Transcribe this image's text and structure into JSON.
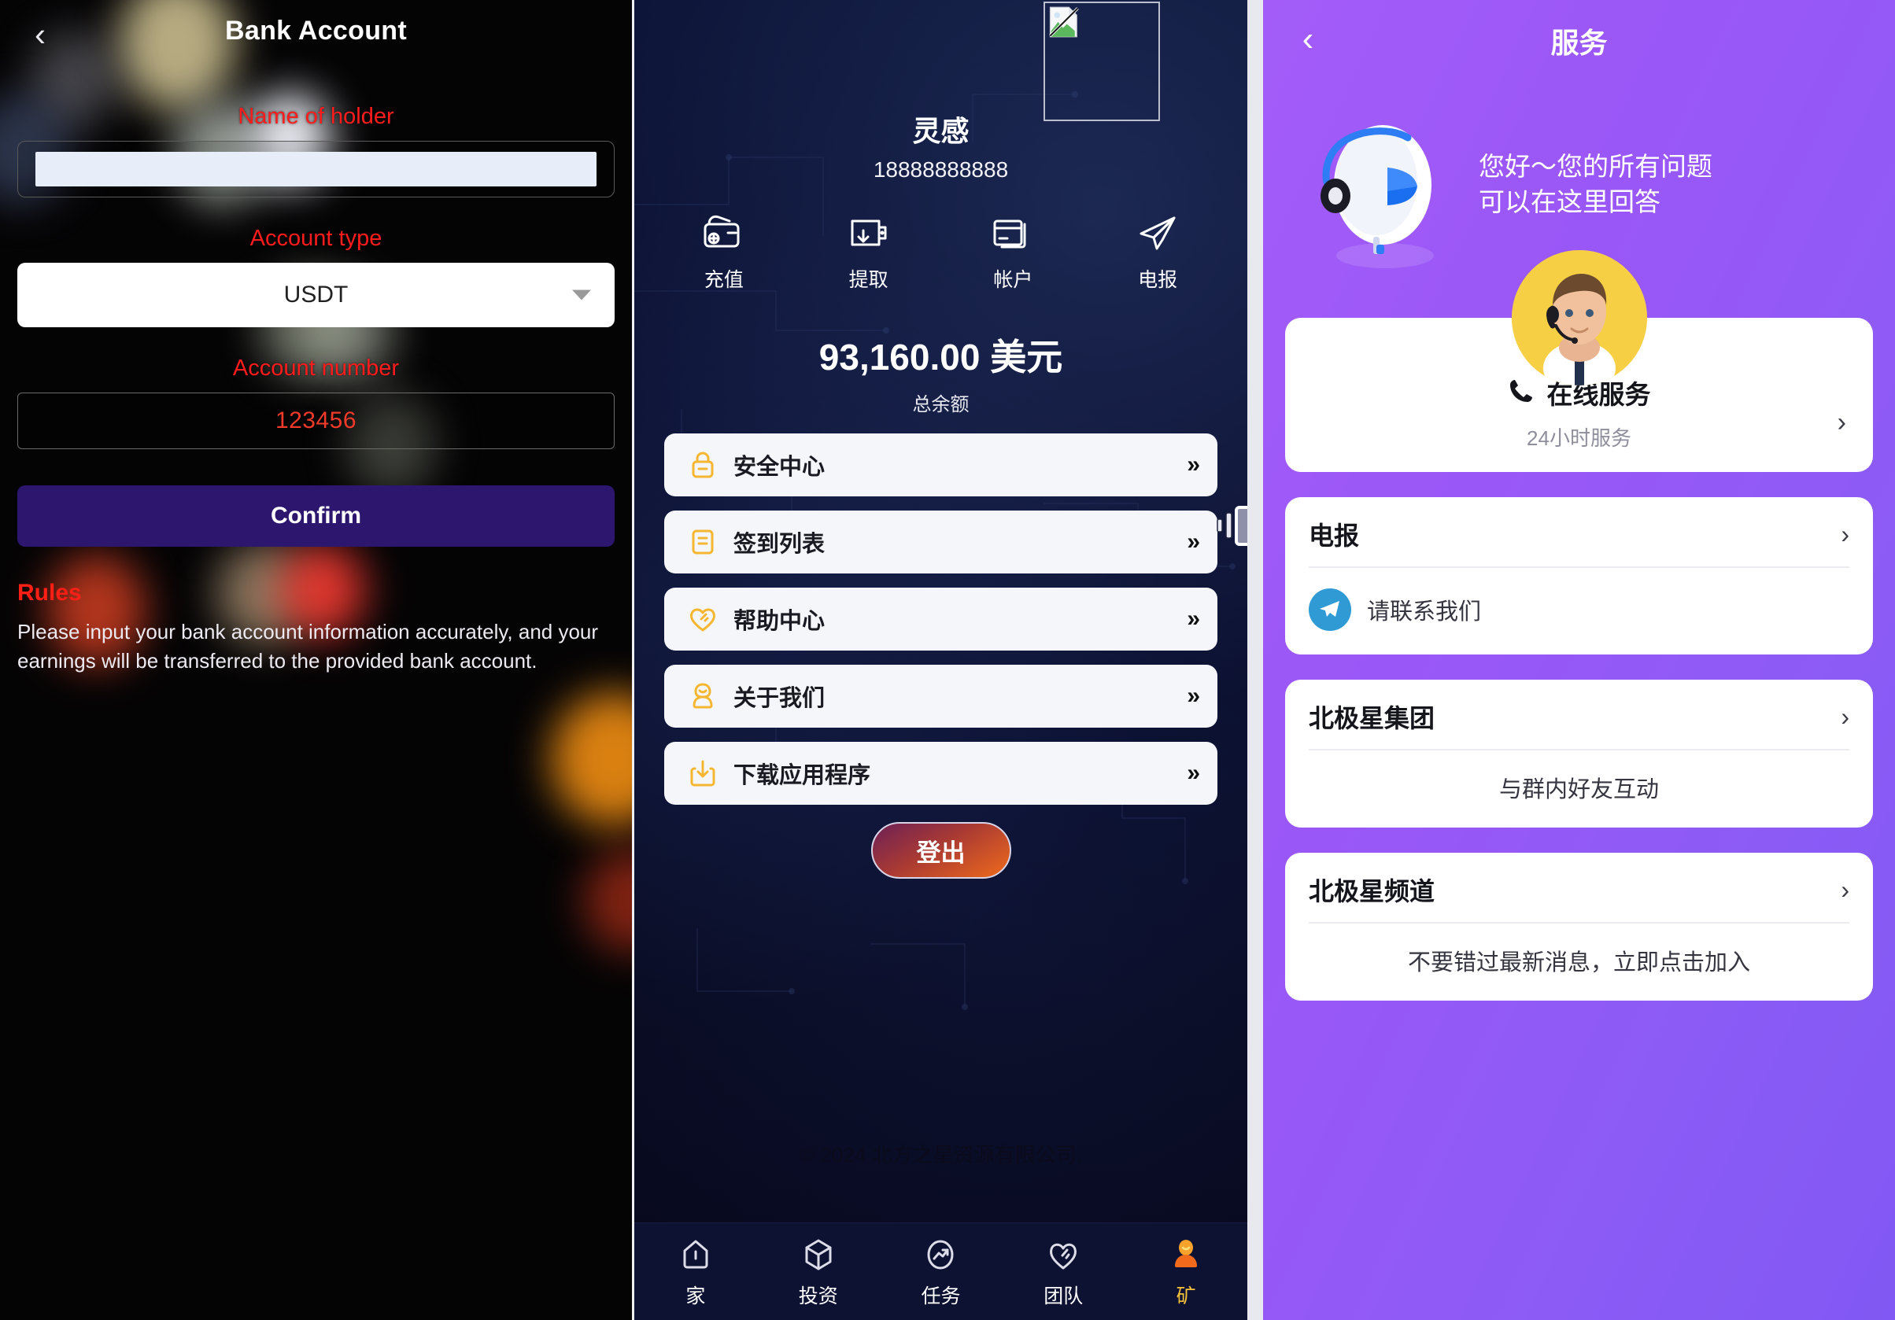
{
  "panel1": {
    "back_icon": "chevron-left-icon",
    "title": "Bank Account",
    "name_label": "Name of holder",
    "name_value": "",
    "name_placeholder": "",
    "type_label": "Account type",
    "type_value": "USDT",
    "caret_icon": "chevron-down-icon",
    "number_label": "Account number",
    "number_value": "123456",
    "confirm_label": "Confirm",
    "rules_heading": "Rules",
    "rules_body": "Please input your bank account information accurately, and your earnings will be transferred to the provided bank account.",
    "colors": {
      "label_red": "#ff1c1c",
      "confirm_bg": "#2c166e",
      "rules_red": "#fb1f16"
    }
  },
  "panel2": {
    "broken_image_icon": "broken-image-placeholder-icon",
    "speaker_icon": "volume-speaker-icon",
    "user_name": "灵感",
    "user_phone": "18888888888",
    "quick_actions": [
      {
        "icon": "wallet-recharge-icon",
        "label": "充值"
      },
      {
        "icon": "wallet-withdraw-icon",
        "label": "提取"
      },
      {
        "icon": "card-account-icon",
        "label": "帐户"
      },
      {
        "icon": "telegram-paperplane-icon",
        "label": "电报"
      }
    ],
    "balance": "93,160.00 美元",
    "balance_sub": "总余额",
    "menu": [
      {
        "icon": "lock-icon",
        "label": "安全中心",
        "arrow": "»"
      },
      {
        "icon": "list-checkin-icon",
        "label": "签到列表",
        "arrow": "»"
      },
      {
        "icon": "heart-help-icon",
        "label": "帮助中心",
        "arrow": "»"
      },
      {
        "icon": "person-about-icon",
        "label": "关于我们",
        "arrow": "»"
      },
      {
        "icon": "download-icon",
        "label": "下载应用程序",
        "arrow": "»"
      }
    ],
    "logout_label": "登出",
    "copyright": "© 2024 北方之星资源有限公司.",
    "tabs": [
      {
        "icon": "home-icon",
        "label": "家",
        "active": false
      },
      {
        "icon": "cube-invest-icon",
        "label": "投资",
        "active": false
      },
      {
        "icon": "trend-task-icon",
        "label": "任务",
        "active": false
      },
      {
        "icon": "heart-team-icon",
        "label": "团队",
        "active": false
      },
      {
        "icon": "miner-icon",
        "label": "矿",
        "active": true
      }
    ],
    "colors": {
      "menu_icon": "#f5b731",
      "active_tab": "#f6c23a",
      "card_bg": "#f5f6fa"
    }
  },
  "panel3": {
    "back_icon": "chevron-left-icon",
    "title": "服务",
    "robot_icon": "headset-robot-icon",
    "hero_line1": "您好～您的所有问题",
    "hero_line2": "可以在这里回答",
    "avatar_icon": "support-agent-avatar",
    "main_card": {
      "phone_icon": "phone-icon",
      "title": "在线服务",
      "subtitle": "24小时服务",
      "chevron": "›"
    },
    "cards": [
      {
        "title": "电报",
        "chevron": "›",
        "icon": "telegram-icon",
        "body": "请联系我们",
        "body_centered": false
      },
      {
        "title": "北极星集团",
        "chevron": "›",
        "icon": "",
        "body": "与群内好友互动",
        "body_centered": true
      },
      {
        "title": "北极星频道",
        "chevron": "›",
        "icon": "",
        "body": "不要错过最新消息，立即点击加入",
        "body_centered": true
      }
    ],
    "colors": {
      "bg_from": "#a35cf8",
      "bg_to": "#8158f3",
      "avatar_bg": "#f6cf45",
      "telegram_blue": "#2f9ad4"
    }
  }
}
